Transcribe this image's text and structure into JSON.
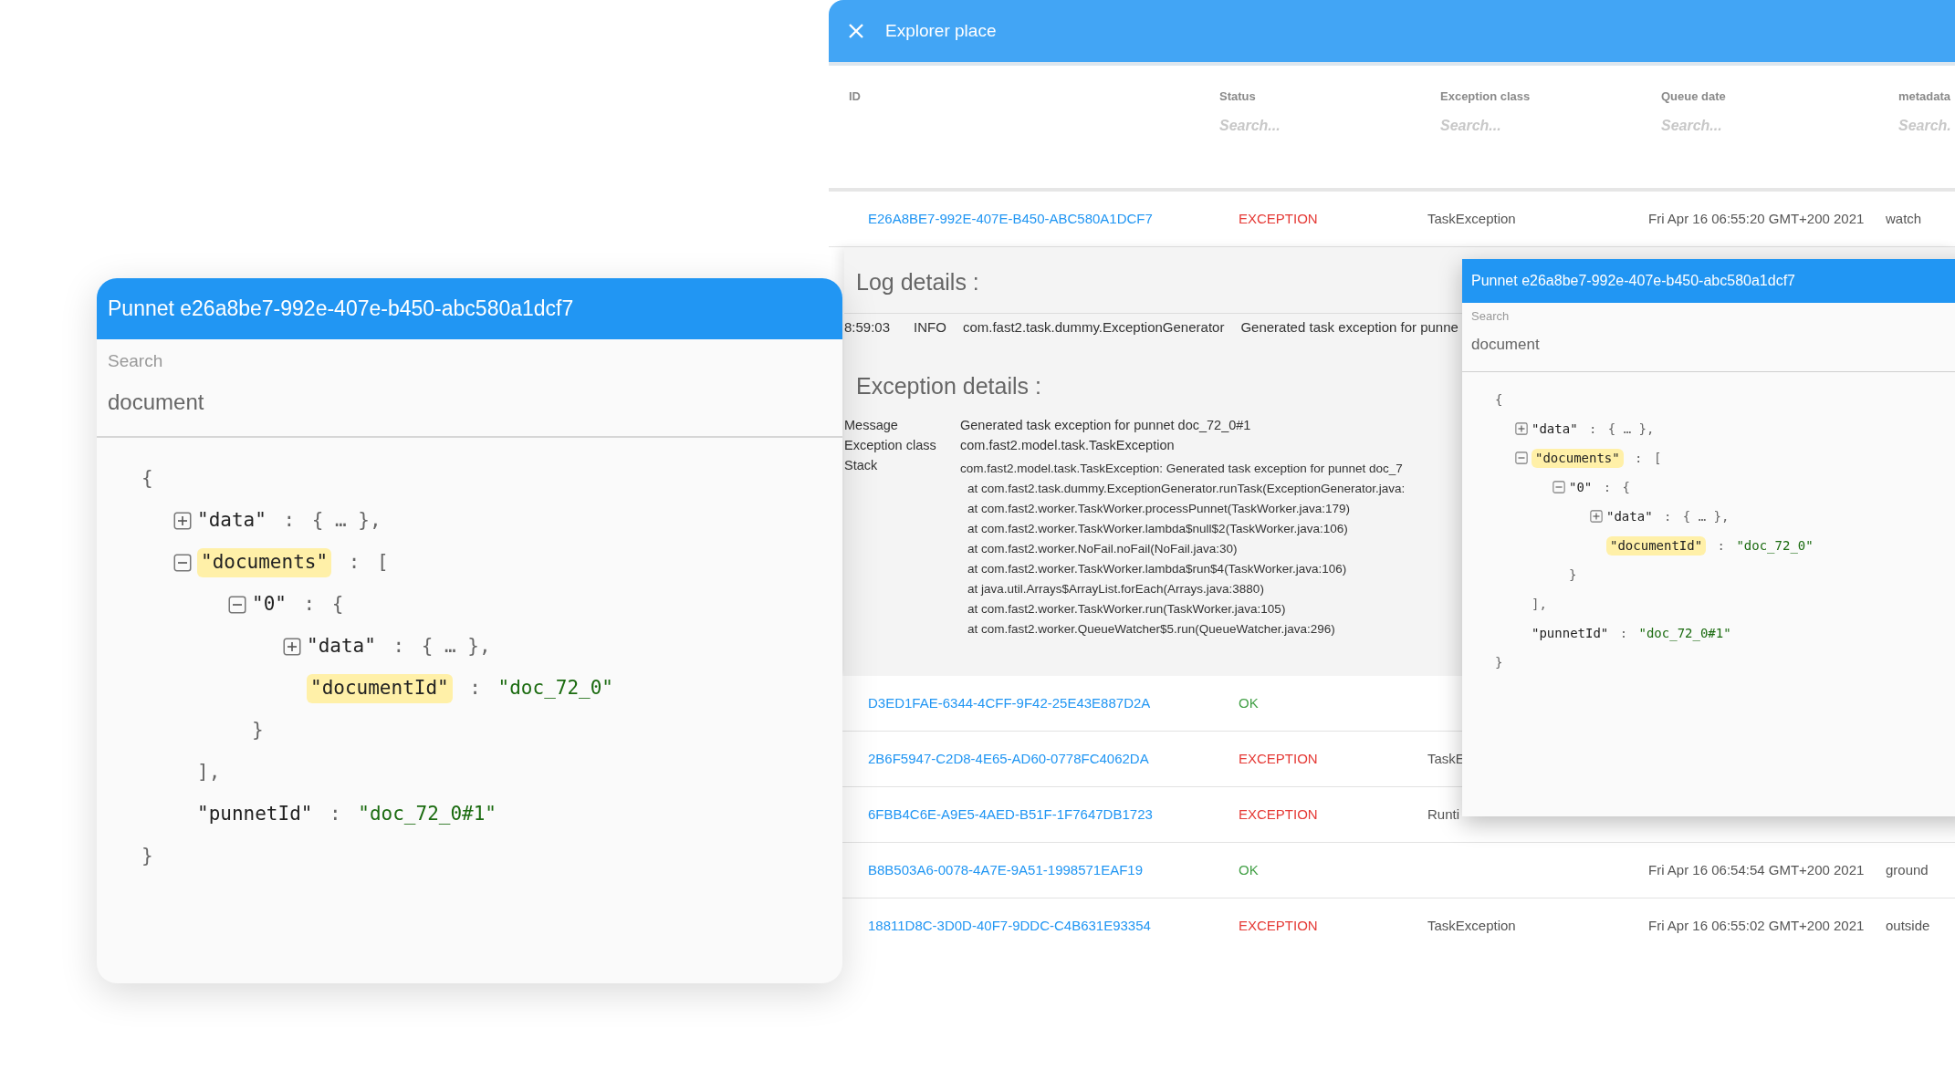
{
  "explorer": {
    "title": "Explorer place",
    "columns": [
      {
        "label": "ID"
      },
      {
        "label": "Status",
        "placeholder": "Search..."
      },
      {
        "label": "Exception class",
        "placeholder": "Search..."
      },
      {
        "label": "Queue date",
        "placeholder": "Search..."
      },
      {
        "label": "metadata",
        "placeholder": "Search."
      }
    ],
    "top_row": {
      "kind": "exception",
      "id": "E26A8BE7-992E-407E-B450-ABC580A1DCF7",
      "status": "EXCEPTION",
      "exception_class": "TaskException",
      "queue_date": "Fri Apr 16 06:55:20 GMT+200 2021",
      "metadata": "watch"
    },
    "log_details": {
      "title": "Log details :",
      "entry": {
        "time": "8:59:03",
        "level": "INFO",
        "logger": "com.fast2.task.dummy.ExceptionGenerator",
        "message": "Generated task exception for punne"
      }
    },
    "exception_details": {
      "title": "Exception details :",
      "fields": [
        {
          "label": "Message",
          "value": "Generated task exception for punnet doc_72_0#1"
        },
        {
          "label": "Exception class",
          "value": "com.fast2.model.task.TaskException"
        }
      ],
      "stack_label": "Stack",
      "stack": [
        "com.fast2.model.task.TaskException: Generated task exception for punnet doc_7",
        "at com.fast2.task.dummy.ExceptionGenerator.runTask(ExceptionGenerator.java:",
        "at com.fast2.worker.TaskWorker.processPunnet(TaskWorker.java:179)",
        "at com.fast2.worker.TaskWorker.lambda$null$2(TaskWorker.java:106)",
        "at com.fast2.worker.NoFail.noFail(NoFail.java:30)",
        "at com.fast2.worker.TaskWorker.lambda$run$4(TaskWorker.java:106)",
        "at java.util.Arrays$ArrayList.forEach(Arrays.java:3880)",
        "at com.fast2.worker.TaskWorker.run(TaskWorker.java:105)",
        "at com.fast2.worker.QueueWatcher$5.run(QueueWatcher.java:296)"
      ]
    },
    "rows": [
      {
        "kind": "ok",
        "id": "D3ED1FAE-6344-4CFF-9F42-25E43E887D2A",
        "status": "OK"
      },
      {
        "kind": "exception",
        "id": "2B6F5947-C2D8-4E65-AD60-0778FC4062DA",
        "status": "EXCEPTION",
        "exception_class": "TaskE"
      },
      {
        "kind": "exception",
        "id": "6FBB4C6E-A9E5-4AED-B51F-1F7647DB1723",
        "status": "EXCEPTION",
        "exception_class": "Runti"
      },
      {
        "kind": "ok",
        "id": "B8B503A6-0078-4A7E-9A51-1998571EAF19",
        "status": "OK",
        "queue_date": "Fri Apr 16 06:54:54 GMT+200 2021",
        "metadata": "ground"
      },
      {
        "kind": "exception",
        "id": "18811D8C-3D0D-40F7-9DDC-C4B631E93354",
        "status": "EXCEPTION",
        "exception_class": "TaskException",
        "queue_date": "Fri Apr 16 06:55:02 GMT+200 2021",
        "metadata": "outside"
      }
    ]
  },
  "popups": [
    {
      "title": "Punnet e26a8be7-992e-407e-b450-abc580a1dcf7",
      "search": {
        "label": "Search",
        "value": "document"
      },
      "tree": {
        "open": "{",
        "close": "}",
        "children": [
          {
            "key": "\"data\"",
            "colon": ":",
            "value": "{ … },",
            "expanded": false
          },
          {
            "key": "\"documents\"",
            "highlighted": true,
            "colon": ":",
            "open": "[",
            "close": "],",
            "expanded": true,
            "children": [
              {
                "key": "\"0\"",
                "colon": ":",
                "open": "{",
                "close": "}",
                "expanded": true,
                "children": [
                  {
                    "key": "\"data\"",
                    "colon": ":",
                    "value": "{ … },",
                    "expanded": false
                  },
                  {
                    "key": "\"documentId\"",
                    "highlighted": true,
                    "colon": ":",
                    "value": "\"doc_72_0\"",
                    "kind": "string"
                  }
                ]
              }
            ]
          },
          {
            "key": "\"punnetId\"",
            "colon": ":",
            "value": "\"doc_72_0#1\"",
            "kind": "string"
          }
        ]
      }
    },
    {
      "title": "Punnet e26a8be7-992e-407e-b450-abc580a1dcf7",
      "search": {
        "label": "Search",
        "value": "document"
      },
      "tree": {
        "open": "{",
        "close": "}",
        "children": [
          {
            "key": "\"data\"",
            "colon": ":",
            "value": "{ … },",
            "expanded": false
          },
          {
            "key": "\"documents\"",
            "highlighted": true,
            "colon": ":",
            "open": "[",
            "close": "],",
            "expanded": true,
            "children": [
              {
                "key": "\"0\"",
                "colon": ":",
                "open": "{",
                "close": "}",
                "expanded": true,
                "children": [
                  {
                    "key": "\"data\"",
                    "colon": ":",
                    "value": "{ … },",
                    "expanded": false
                  },
                  {
                    "key": "\"documentId\"",
                    "highlighted": true,
                    "colon": ":",
                    "value": "\"doc_72_0\"",
                    "kind": "string"
                  }
                ]
              }
            ]
          },
          {
            "key": "\"punnetId\"",
            "colon": ":",
            "value": "\"doc_72_0#1\"",
            "kind": "string"
          }
        ]
      }
    }
  ]
}
